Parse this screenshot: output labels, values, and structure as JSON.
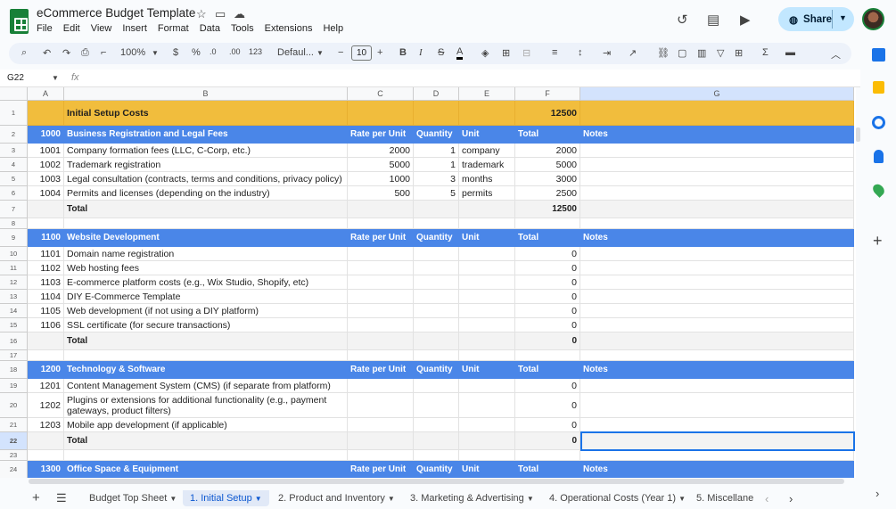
{
  "app": {
    "title": "eCommerce Budget Template",
    "menu": [
      "File",
      "Edit",
      "View",
      "Insert",
      "Format",
      "Data",
      "Tools",
      "Extensions",
      "Help"
    ],
    "share_label": "Share"
  },
  "toolbar": {
    "zoom": "100%",
    "currency": "$",
    "percent": "%",
    "decrease_decimal": ".0",
    "increase_decimal": ".00",
    "number_format": "123",
    "font": "Defaul...",
    "font_size": "10"
  },
  "formula_bar": {
    "cell": "G22",
    "fx": "fx",
    "value": ""
  },
  "columns": [
    "A",
    "B",
    "C",
    "D",
    "E",
    "F",
    "G"
  ],
  "rows": [
    {
      "n": "1",
      "type": "yellow",
      "cells": [
        "",
        "Initial Setup Costs",
        "",
        "",
        "",
        "12500",
        ""
      ]
    },
    {
      "n": "2",
      "type": "blue",
      "cells": [
        "1000",
        "Business Registration and Legal Fees",
        "Rate per Unit",
        "Quantity",
        "Unit",
        "Total",
        "Notes"
      ]
    },
    {
      "n": "3",
      "type": "data",
      "cells": [
        "1001",
        "Company formation fees (LLC, C-Corp, etc.)",
        "2000",
        "1",
        "company",
        "2000",
        ""
      ]
    },
    {
      "n": "4",
      "type": "data",
      "cells": [
        "1002",
        "Trademark registration",
        "5000",
        "1",
        "trademark",
        "5000",
        ""
      ]
    },
    {
      "n": "5",
      "type": "data",
      "cells": [
        "1003",
        "Legal consultation (contracts, terms and conditions, privacy policy)",
        "1000",
        "3",
        "months",
        "3000",
        ""
      ]
    },
    {
      "n": "6",
      "type": "data",
      "cells": [
        "1004",
        "Permits and licenses (depending on the industry)",
        "500",
        "5",
        "permits",
        "2500",
        ""
      ]
    },
    {
      "n": "7",
      "type": "tot",
      "cells": [
        "",
        "Total",
        "",
        "",
        "",
        "12500",
        ""
      ]
    },
    {
      "n": "8",
      "type": "empty",
      "cells": [
        "",
        "",
        "",
        "",
        "",
        "",
        ""
      ]
    },
    {
      "n": "9",
      "type": "blue",
      "cells": [
        "1100",
        "Website Development",
        "Rate per Unit",
        "Quantity",
        "Unit",
        "Total",
        "Notes"
      ]
    },
    {
      "n": "10",
      "type": "data",
      "cells": [
        "1101",
        "Domain name registration",
        "",
        "",
        "",
        "0",
        ""
      ]
    },
    {
      "n": "11",
      "type": "data",
      "cells": [
        "1102",
        "Web hosting fees",
        "",
        "",
        "",
        "0",
        ""
      ]
    },
    {
      "n": "12",
      "type": "data",
      "cells": [
        "1103",
        "E-commerce platform costs (e.g., Wix Studio, Shopify, etc)",
        "",
        "",
        "",
        "0",
        ""
      ]
    },
    {
      "n": "13",
      "type": "data",
      "cells": [
        "1104",
        "DIY E-Commerce Template",
        "",
        "",
        "",
        "0",
        ""
      ]
    },
    {
      "n": "14",
      "type": "data",
      "cells": [
        "1105",
        "Web development (if not using a DIY platform)",
        "",
        "",
        "",
        "0",
        ""
      ]
    },
    {
      "n": "15",
      "type": "data",
      "cells": [
        "1106",
        "SSL certificate (for secure transactions)",
        "",
        "",
        "",
        "0",
        ""
      ]
    },
    {
      "n": "16",
      "type": "tot",
      "cells": [
        "",
        "Total",
        "",
        "",
        "",
        "0",
        ""
      ]
    },
    {
      "n": "17",
      "type": "empty",
      "cells": [
        "",
        "",
        "",
        "",
        "",
        "",
        ""
      ]
    },
    {
      "n": "18",
      "type": "blue",
      "cells": [
        "1200",
        "Technology & Software",
        "Rate per Unit",
        "Quantity",
        "Unit",
        "Total",
        "Notes"
      ]
    },
    {
      "n": "19",
      "type": "data",
      "cells": [
        "1201",
        "Content Management System (CMS) (if separate from platform)",
        "",
        "",
        "",
        "0",
        ""
      ]
    },
    {
      "n": "20",
      "type": "data",
      "cells": [
        "1202",
        "Plugins or extensions for additional functionality (e.g., payment gateways, product filters)",
        "",
        "",
        "",
        "0",
        ""
      ]
    },
    {
      "n": "21",
      "type": "data",
      "cells": [
        "1203",
        "Mobile app development (if applicable)",
        "",
        "",
        "",
        "0",
        ""
      ]
    },
    {
      "n": "22",
      "type": "tot",
      "cells": [
        "",
        "Total",
        "",
        "",
        "",
        "0",
        ""
      ]
    },
    {
      "n": "23",
      "type": "empty",
      "cells": [
        "",
        "",
        "",
        "",
        "",
        "",
        ""
      ]
    },
    {
      "n": "24",
      "type": "blue",
      "cells": [
        "1300",
        "Office Space & Equipment",
        "Rate per Unit",
        "Quantity",
        "Unit",
        "Total",
        "Notes"
      ]
    }
  ],
  "tabs": [
    "Budget Top Sheet",
    "1. Initial Setup",
    "2. Product and Inventory",
    "3. Marketing & Advertising",
    "4. Operational Costs (Year 1)",
    "5. Miscellane"
  ],
  "colors": {
    "header_yellow": "#f1bd3d",
    "header_blue": "#4a86e8",
    "selection": "#1a73e8",
    "share_bg": "#c2e7ff"
  }
}
